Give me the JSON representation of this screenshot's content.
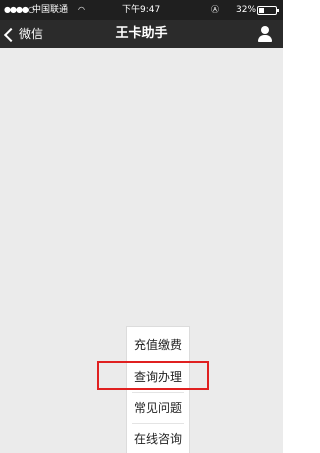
{
  "status_bar": {
    "signal": "●●●●○",
    "carrier": "中国联通",
    "wifi_icon": "wifi-icon",
    "time": "下午9:47",
    "lock_icon": "rotation-lock-icon",
    "battery_text": "32%",
    "battery_level": 0.32
  },
  "nav": {
    "back_label": "微信",
    "title": "王卡助手",
    "user_icon": "user-icon"
  },
  "menu": {
    "items": [
      "充值缴费",
      "查询办理",
      "常见问题",
      "在线咨询"
    ],
    "highlighted_index": 1
  },
  "colors": {
    "status_bar": "#1f1f1f",
    "nav_bar": "#2b2b2b",
    "content_bg": "#ebebeb",
    "highlight": "#e02020"
  }
}
